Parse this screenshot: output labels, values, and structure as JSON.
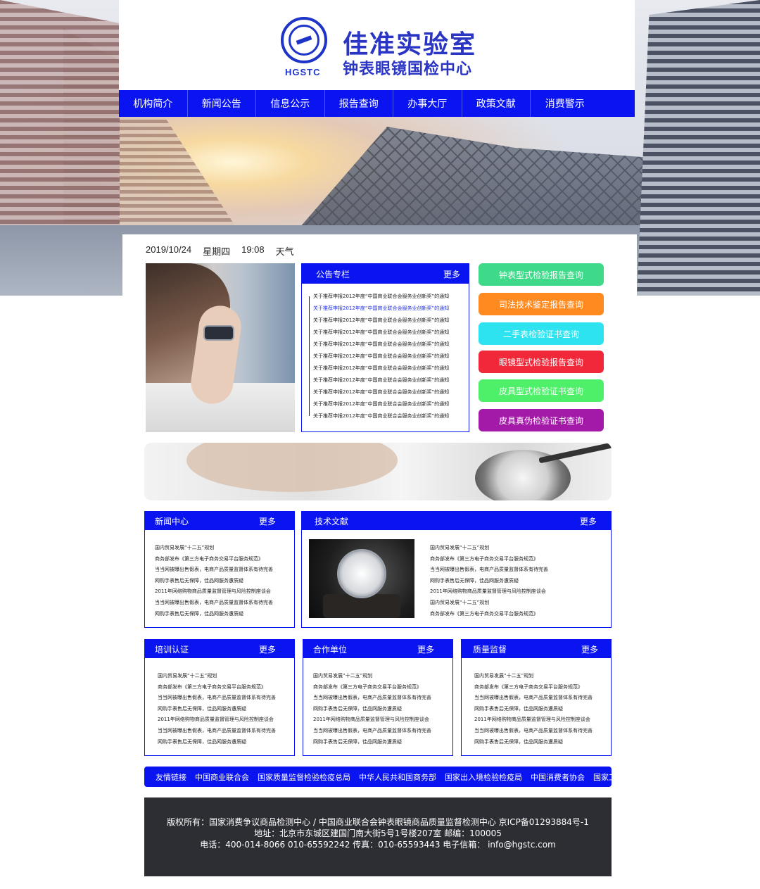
{
  "header": {
    "logo_text": "HGSTC",
    "title": "佳准实验室",
    "subtitle": "钟表眼镜国检中心"
  },
  "nav": [
    "机构简介",
    "新闻公告",
    "信息公示",
    "报告查询",
    "办事大厅",
    "政策文献",
    "消费警示"
  ],
  "datebar": {
    "date": "2019/10/24",
    "weekday": "星期四",
    "time": "19:08",
    "weather": "天气"
  },
  "announce": {
    "title": "公告专栏",
    "more": "更多",
    "items": [
      "关于推荐申报2012年度“中国商业联合会服务业创新奖”的通知",
      "关于推荐申报2012年度“中国商业联合会服务业创新奖”的通知",
      "关于推荐申报2012年度“中国商业联合会服务业创新奖”的通知",
      "关于推荐申报2012年度“中国商业联合会服务业创新奖”的通知",
      "关于推荐申报2012年度“中国商业联合会服务业创新奖”的通知",
      "关于推荐申报2012年度“中国商业联合会服务业创新奖”的通知",
      "关于推荐申报2012年度“中国商业联合会服务业创新奖”的通知",
      "关于推荐申报2012年度“中国商业联合会服务业创新奖”的通知",
      "关于推荐申报2012年度“中国商业联合会服务业创新奖”的通知",
      "关于推荐申报2012年度“中国商业联合会服务业创新奖”的通知",
      "关于推荐申报2012年度“中国商业联合会服务业创新奖”的通知"
    ]
  },
  "queries": [
    {
      "label": "钟表型式检验报告查询",
      "color": "#3fd98a"
    },
    {
      "label": "司法技术鉴定报告查询",
      "color": "#ff8a1f"
    },
    {
      "label": "二手表检验证书查询",
      "color": "#2de3f0"
    },
    {
      "label": "眼镜型式检验报告查询",
      "color": "#f0283a"
    },
    {
      "label": "皮具型式检验证书查询",
      "color": "#4ef06a"
    },
    {
      "label": "皮具真伪检验证书查询",
      "color": "#a41aa8"
    }
  ],
  "news": {
    "title": "新闻中心",
    "more": "更多",
    "items": [
      "国内贸易发展“十二五”规划",
      "商务部发布《第三方电子商务交易平台服务规范》",
      "当当网被曝出售假表，电商产品质量监督体系有待完善",
      "网购手表售后无保障，佳品网服务遭质疑",
      "2011年网络购物商品质量监督管理与风险控制座谈会",
      "当当网被曝出售假表，电商产品质量监督体系有待完善",
      "网购手表售后无保障，佳品网服务遭质疑"
    ]
  },
  "tech": {
    "title": "技术文献",
    "more": "更多",
    "items": [
      "国内贸易发展“十二五”规划",
      "商务部发布《第三方电子商务交易平台服务规范》",
      "当当网被曝出售假表，电商产品质量监督体系有待完善",
      "网购手表售后无保障，佳品网服务遭质疑",
      "2011年网络购物商品质量监督管理与风险控制座谈会",
      "国内贸易发展“十二五”规划",
      "商务部发布《第三方电子商务交易平台服务规范》"
    ]
  },
  "training": {
    "title": "培训认证",
    "more": "更多",
    "items": [
      "国内贸易发展“十二五”规划",
      "商务部发布《第三方电子商务交易平台服务规范》",
      "当当网被曝出售假表，电商产品质量监督体系有待完善",
      "网购手表售后无保障，佳品网服务遭质疑",
      "2011年网络购物商品质量监督管理与风险控制座谈会",
      "当当网被曝出售假表，电商产品质量监督体系有待完善",
      "网购手表售后无保障，佳品网服务遭质疑"
    ]
  },
  "partners": {
    "title": "合作单位",
    "more": "更多",
    "items": [
      "国内贸易发展“十二五”规划",
      "商务部发布《第三方电子商务交易平台服务规范》",
      "当当网被曝出售假表，电商产品质量监督体系有待完善",
      "网购手表售后无保障，佳品网服务遭质疑",
      "2011年网络购物商品质量监督管理与风险控制座谈会",
      "当当网被曝出售假表，电商产品质量监督体系有待完善",
      "网购手表售后无保障，佳品网服务遭质疑"
    ]
  },
  "quality": {
    "title": "质量监督",
    "more": "更多",
    "items": [
      "国内贸易发展“十二五”规划",
      "商务部发布《第三方电子商务交易平台服务规范》",
      "当当网被曝出售假表，电商产品质量监督体系有待完善",
      "网购手表售后无保障，佳品网服务遭质疑",
      "2011年网络购物商品质量监督管理与风险控制座谈会",
      "当当网被曝出售假表，电商产品质量监督体系有待完善",
      "网购手表售后无保障，佳品网服务遭质疑"
    ]
  },
  "links": {
    "title": "友情链接",
    "items": [
      "中国商业联合会",
      "国家质量监督检验检疫总局",
      "中华人民共和国商务部",
      "国家出入境检验检疫局",
      "中国消费者协会",
      "国家工商总局"
    ]
  },
  "footer": {
    "line1": "版权所有：国家消费争议商品检测中心 / 中国商业联合会钟表眼镜商品质量监督检测中心   京ICP备01293884号-1",
    "line2": "地址：北京市东城区建国门南大街5号1号楼207室    邮编：100005",
    "line3": "电话：400-014-8066 010-65592242    传真：010-65593443    电子信箱： info@hgstc.com"
  },
  "colors": {
    "brand_blue": "#0a14f0",
    "title_blue": "#2a35c4",
    "footer_bg": "#2d2e33"
  }
}
